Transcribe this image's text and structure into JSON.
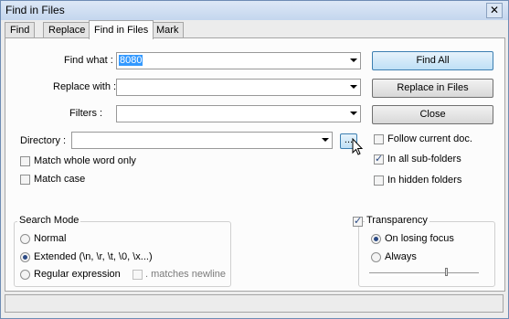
{
  "window": {
    "title": "Find in Files",
    "close_symbol": "✕"
  },
  "tabs": [
    {
      "label": "Find",
      "active": false
    },
    {
      "label": "Replace",
      "active": false
    },
    {
      "label": "Find in Files",
      "active": true
    },
    {
      "label": "Mark",
      "active": false
    }
  ],
  "form": {
    "find_what_label": "Find what :",
    "find_what_value": "8080",
    "replace_with_label": "Replace with :",
    "replace_with_value": "",
    "filters_label": "Filters :",
    "filters_value": "",
    "directory_label": "Directory :",
    "directory_value": "",
    "directory_browse_label": "..."
  },
  "buttons": {
    "find_all": "Find All",
    "replace_in_files": "Replace in Files",
    "close": "Close"
  },
  "options_left": {
    "match_whole_word": {
      "label": "Match whole word only",
      "checked": false
    },
    "match_case": {
      "label": "Match case",
      "checked": false
    }
  },
  "options_right": {
    "follow_current_doc": {
      "label": "Follow current doc.",
      "checked": false
    },
    "in_all_subfolders": {
      "label": "In all sub-folders",
      "checked": true
    },
    "in_hidden_folders": {
      "label": "In hidden folders",
      "checked": false
    }
  },
  "search_mode": {
    "title": "Search Mode",
    "normal": "Normal",
    "extended": "Extended (\\n, \\r, \\t, \\0, \\x...)",
    "regex": "Regular expression",
    "matches_newline": ". matches newline",
    "selected": "extended"
  },
  "transparency": {
    "title": "Transparency",
    "enabled": true,
    "on_losing_focus": "On losing focus",
    "always": "Always",
    "selected": "on_losing_focus",
    "slider_value": 0.7
  },
  "colors": {
    "accent": "#3399ff",
    "check": "#2b4a84",
    "default_button": "#bfe0f6"
  }
}
